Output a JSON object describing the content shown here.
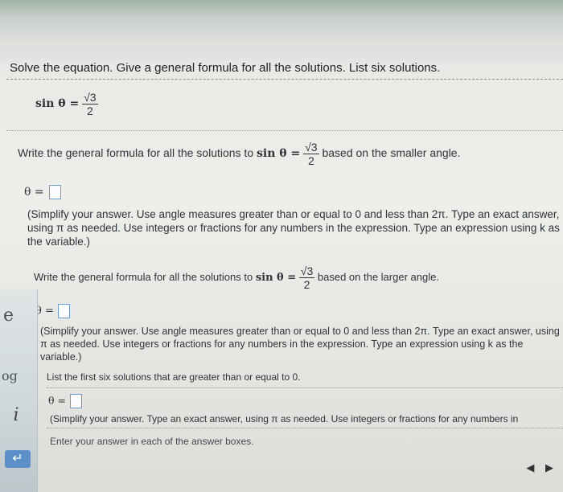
{
  "question": {
    "prompt": "Solve the equation. Give a general formula for all the solutions. List six solutions.",
    "given": {
      "lhs": "sin θ =",
      "numerator": "√3",
      "denominator": "2"
    }
  },
  "part1": {
    "instruction_pre": "Write the general formula for all the solutions to",
    "instruction_eq": "sin θ =",
    "numerator": "√3",
    "denominator": "2",
    "instruction_post": "based on the smaller angle.",
    "answer_label": "θ =",
    "hint": "(Simplify your answer. Use angle measures greater than or equal to 0 and less than 2π. Type an exact answer, using π as needed. Use integers or fractions for any numbers in the expression. Type an expression using k as the variable.)"
  },
  "part2": {
    "instruction_pre": "Write the general formula for all the solutions to",
    "instruction_eq": "sin θ =",
    "numerator": "√3",
    "denominator": "2",
    "instruction_post": "based on the larger angle.",
    "answer_label": "θ =",
    "hint": "(Simplify your answer. Use angle measures greater than or equal to 0 and less than 2π. Type an exact answer, using π as needed. Use integers or fractions for any numbers in the expression. Type an expression using k as the variable.)"
  },
  "part3": {
    "instruction": "List the first six solutions that are greater than or equal to 0.",
    "answer_label": "θ =",
    "hint": "(Simplify your answer. Type an exact answer, using π as needed. Use integers or fractions for any numbers in"
  },
  "footer": {
    "enter_text": "Enter your answer in each of the answer boxes."
  },
  "sidebar": {
    "glyph_e": "e",
    "glyph_og": "og",
    "info_glyph": "i",
    "return_glyph": "↵"
  },
  "nav": {
    "prev": "◀",
    "next": "▶"
  }
}
